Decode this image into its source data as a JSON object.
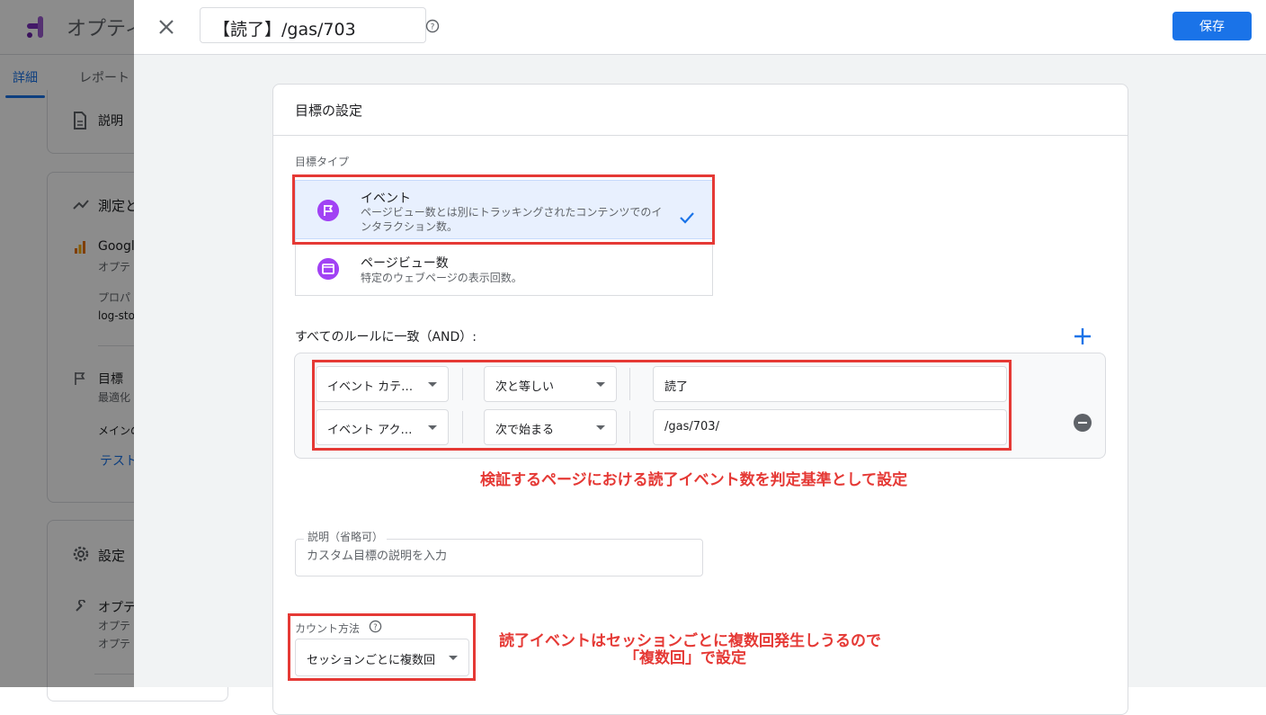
{
  "background_app": {
    "title": "オプティ",
    "tabs": [
      "詳細",
      "レポート"
    ],
    "description_card_label": "説明",
    "measure_card": {
      "heading": "測定と",
      "property_name": "Googl",
      "property_sub": "オプテ",
      "prop_label": "プロパ",
      "prop_value": "log-sto",
      "goal_label": "目標",
      "goal_sub": "最適化",
      "main_label": "メインの",
      "test_link": "テスト"
    },
    "settings_card": {
      "heading": "設定",
      "item_title": "オプテ",
      "item_sub1": "オプテ",
      "item_sub2": "オプテ"
    }
  },
  "header": {
    "title": "【読了】/gas/703",
    "save_label": "保存"
  },
  "goal_card": {
    "title": "目標の設定",
    "goal_type_label": "目標タイプ",
    "options": [
      {
        "title": "イベント",
        "description": "ページビュー数とは別にトラッキングされたコンテンツでのインタラクション数。",
        "selected": true,
        "icon": "flag-icon"
      },
      {
        "title": "ページビュー数",
        "description": "特定のウェブページの表示回数。",
        "selected": false,
        "icon": "browser-window-icon"
      }
    ],
    "rules_label": "すべてのルールに一致（AND）:",
    "rules": [
      {
        "field": "イベント カテ…",
        "operator": "次と等しい",
        "value": "読了"
      },
      {
        "field": "イベント アク…",
        "operator": "次で始まる",
        "value": "/gas/703/"
      }
    ],
    "description_label": "説明（省略可）",
    "description_placeholder": "カスタム目標の説明を入力",
    "count_label": "カウント方法",
    "count_value": "セッションごとに複数回"
  },
  "annotations": {
    "rule_note": "検証するページにおける読了イベント数を判定基準として設定",
    "count_note_line1": "読了イベントはセッションごとに複数回発生しうるので",
    "count_note_line2": "「複数回」で設定"
  },
  "colors": {
    "primary": "#1a73e8",
    "annotation_red": "#e53935",
    "icon_purple": "#a142f4"
  }
}
